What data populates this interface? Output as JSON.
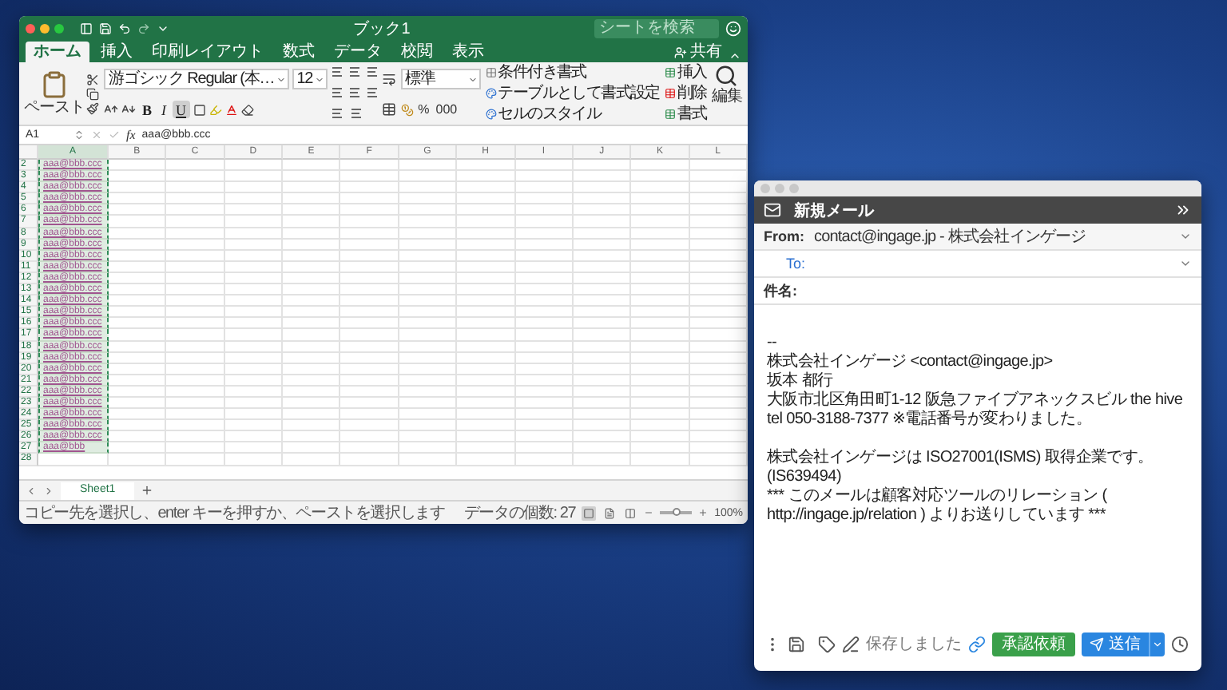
{
  "excel": {
    "title": "ブック1",
    "search": {
      "placeholder": "シートを検索"
    },
    "tabs": [
      {
        "label": "ホーム",
        "selected": true
      },
      {
        "label": "挿入",
        "selected": false
      },
      {
        "label": "印刷レイアウト",
        "selected": false
      },
      {
        "label": "数式",
        "selected": false
      },
      {
        "label": "データ",
        "selected": false
      },
      {
        "label": "校閲",
        "selected": false
      },
      {
        "label": "表示",
        "selected": false
      }
    ],
    "share_label": "共有",
    "ribbon": {
      "paste_label": "ペースト",
      "font_name": "游ゴシック Regular (本…",
      "font_size": "12",
      "font_styles": [
        {
          "label": "B",
          "selected": false
        },
        {
          "label": "I",
          "selected": false
        },
        {
          "label": "U",
          "selected": true
        }
      ],
      "number_format": "標準",
      "number_buttons": [
        "%",
        "000"
      ],
      "styles_commands": [
        "条件付き書式",
        "テーブルとして書式設定",
        "セルのスタイル"
      ],
      "cells_commands": [
        "挿入",
        "削除",
        "書式"
      ],
      "editing_label": "編集"
    },
    "name_box": "A1",
    "function_label": "fx",
    "formula": "aaa@bbb.ccc",
    "columns": [
      "A",
      "B",
      "C",
      "D",
      "E",
      "F",
      "G",
      "H",
      "I",
      "J",
      "K",
      "L"
    ],
    "rows": [
      {
        "number": "2",
        "a": "aaa@bbb.ccc"
      },
      {
        "number": "3",
        "a": "aaa@bbb.ccc"
      },
      {
        "number": "4",
        "a": "aaa@bbb.ccc"
      },
      {
        "number": "5",
        "a": "aaa@bbb.ccc"
      },
      {
        "number": "6",
        "a": "aaa@bbb.ccc"
      },
      {
        "number": "7",
        "a": "aaa@bbb.ccc"
      },
      {
        "number": "8",
        "a": "aaa@bbb.ccc"
      },
      {
        "number": "9",
        "a": "aaa@bbb.ccc"
      },
      {
        "number": "10",
        "a": "aaa@bbb.ccc"
      },
      {
        "number": "11",
        "a": "aaa@bbb.ccc"
      },
      {
        "number": "12",
        "a": "aaa@bbb.ccc"
      },
      {
        "number": "13",
        "a": "aaa@bbb.ccc"
      },
      {
        "number": "14",
        "a": "aaa@bbb.ccc"
      },
      {
        "number": "15",
        "a": "aaa@bbb.ccc"
      },
      {
        "number": "16",
        "a": "aaa@bbb.ccc"
      },
      {
        "number": "17",
        "a": "aaa@bbb.ccc"
      },
      {
        "number": "18",
        "a": "aaa@bbb.ccc"
      },
      {
        "number": "19",
        "a": "aaa@bbb.ccc"
      },
      {
        "number": "20",
        "a": "aaa@bbb.ccc"
      },
      {
        "number": "21",
        "a": "aaa@bbb.ccc"
      },
      {
        "number": "22",
        "a": "aaa@bbb.ccc"
      },
      {
        "number": "23",
        "a": "aaa@bbb.ccc"
      },
      {
        "number": "24",
        "a": "aaa@bbb.ccc"
      },
      {
        "number": "25",
        "a": "aaa@bbb.ccc"
      },
      {
        "number": "26",
        "a": "aaa@bbb.ccc"
      },
      {
        "number": "27",
        "a": "aaa@bbb"
      },
      {
        "number": "28"
      }
    ],
    "sheet_tabs": [
      {
        "label": "Sheet1",
        "selected": true
      }
    ],
    "status": {
      "message": "コピー先を選択し、enter キーを押すか、ペーストを選択します",
      "count": "データの個数: 27",
      "views": [
        {
          "selected": true
        },
        {
          "selected": false
        },
        {
          "selected": false
        }
      ],
      "zoom": {
        "level": 0.5,
        "reading": "100%"
      }
    }
  },
  "mail": {
    "title": "新規メール",
    "from": {
      "label": "From:",
      "value": "contact@ingage.jp - 株式会社インゲージ"
    },
    "to": {
      "label": "To:"
    },
    "subject": {
      "label": "件名:"
    },
    "body": [
      [
        "--",
        "株式会社インゲージ <contact@ingage.jp>",
        "坂本 都行",
        "大阪市北区角田町1-12 阪急ファイブアネックスビル the hive",
        "tel 050-3188-7377 ※電話番号が変わりました。"
      ],
      [
        "株式会社インゲージは ISO27001(ISMS) 取得企業です。(IS639494)",
        "*** このメールは顧客対応ツールのリレーション ( http://ingage.jp/relation ) よりお送りしています ***"
      ]
    ],
    "footer": {
      "saved": "保存しました",
      "approve_button": "承認依頼",
      "send_button": "送信"
    }
  }
}
